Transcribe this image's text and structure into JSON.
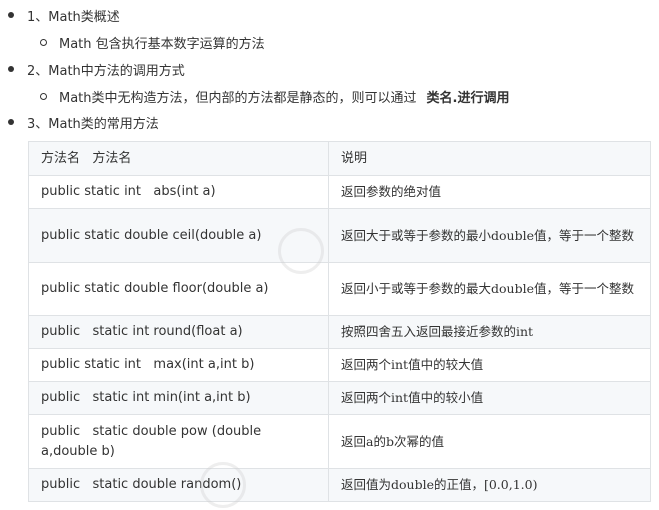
{
  "sections": [
    {
      "label": "1、Math类概述",
      "sub": {
        "text": "Math 包含执行基本数字运算的方法",
        "strong": ""
      }
    },
    {
      "label": "2、Math中方法的调用方式",
      "sub": {
        "text": "Math类中无构造方法，但内部的方法都是静态的，则可以通过",
        "strong": "类名.进行调用"
      }
    },
    {
      "label": "3、Math类的常用方法",
      "sub": null
    }
  ],
  "table": {
    "headers": [
      "方法名   方法名",
      "说明"
    ],
    "rows": [
      {
        "method": "public static int   abs(int a)",
        "desc": "返回参数的绝对值"
      },
      {
        "method": "public static double ceil(double a)",
        "desc": "返回大于或等于参数的最小double值，等于一个整数"
      },
      {
        "method": "public static double floor(double a)",
        "desc": "返回小于或等于参数的最大double值，等于一个整数"
      },
      {
        "method": "public   static int round(float a)",
        "desc": "按照四舍五入返回最接近参数的int"
      },
      {
        "method": "public static int   max(int a,int b)",
        "desc": "返回两个int值中的较大值"
      },
      {
        "method": "public   static int min(int a,int b)",
        "desc": "返回两个int值中的较小值"
      },
      {
        "method": "public   static double pow (double a,double b)",
        "desc": "返回a的b次幂的值"
      },
      {
        "method": "public   static double random()",
        "desc": "返回值为double的正值，[0.0,1.0)"
      }
    ]
  }
}
